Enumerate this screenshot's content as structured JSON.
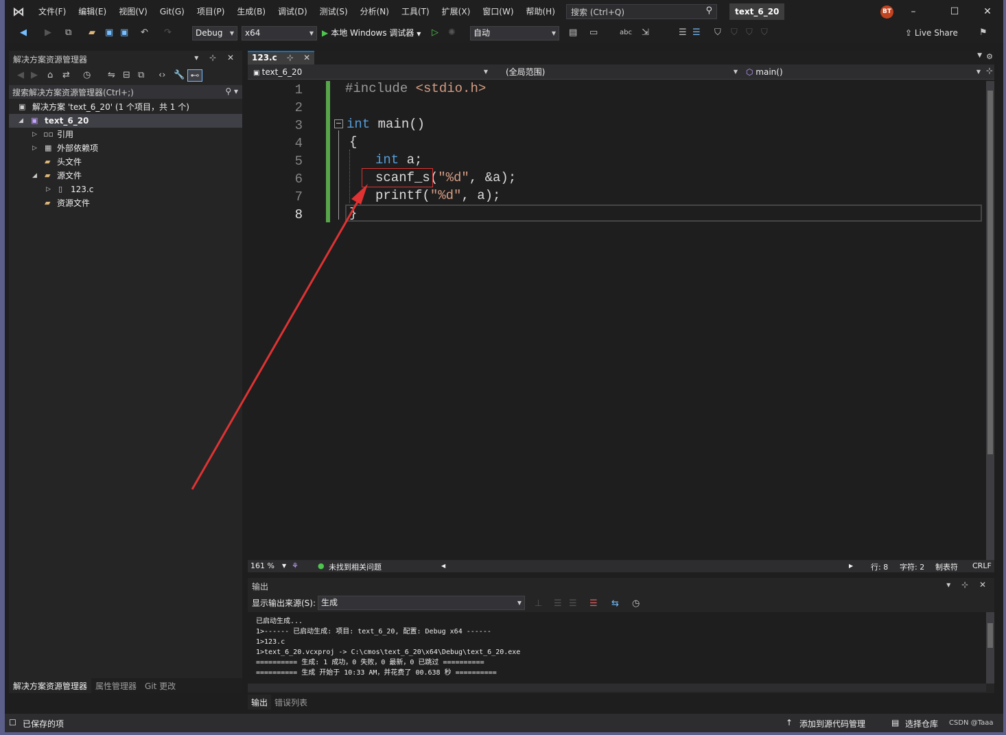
{
  "titlebar": {
    "menu": [
      "文件(F)",
      "编辑(E)",
      "视图(V)",
      "Git(G)",
      "项目(P)",
      "生成(B)",
      "调试(D)",
      "测试(S)",
      "分析(N)",
      "工具(T)",
      "扩展(X)",
      "窗口(W)",
      "帮助(H)"
    ],
    "search_placeholder": "搜索 (Ctrl+Q)",
    "solution_name": "text_6_20",
    "avatar_initials": "BT"
  },
  "toolbar": {
    "config": "Debug",
    "platform": "x64",
    "run_label": "本地 Windows 调试器",
    "auto_label": "自动",
    "live_share": "Live Share"
  },
  "solution_explorer": {
    "title": "解决方案资源管理器",
    "search_placeholder": "搜索解决方案资源管理器(Ctrl+;)",
    "tree": [
      {
        "label": "解决方案 'text_6_20' (1 个项目，共 1 个)"
      },
      {
        "label": "text_6_20"
      },
      {
        "label": "引用"
      },
      {
        "label": "外部依赖项"
      },
      {
        "label": "头文件"
      },
      {
        "label": "源文件"
      },
      {
        "label": "123.c"
      },
      {
        "label": "资源文件"
      }
    ],
    "bottom_tabs": [
      "解决方案资源管理器",
      "属性管理器",
      "Git 更改"
    ]
  },
  "editor": {
    "tab_name": "123.c",
    "nav_project": "text_6_20",
    "nav_scope": "(全局范围)",
    "nav_function": "main()",
    "line_numbers": [
      "1",
      "2",
      "3",
      "4",
      "5",
      "6",
      "7",
      "8"
    ],
    "zoom": "161 %",
    "issues": "未找到相关问题",
    "line_info": "行: 8",
    "char_info": "字符: 2",
    "tab_mode": "制表符",
    "eol": "CRLF"
  },
  "output": {
    "title": "输出",
    "source_label": "显示输出来源(S):",
    "source_value": "生成",
    "lines": [
      "已启动生成...",
      "1>------ 已启动生成: 项目: text_6_20, 配置: Debug x64 ------",
      "1>123.c",
      "1>text_6_20.vcxproj -> C:\\cmos\\text_6_20\\x64\\Debug\\text_6_20.exe",
      "========== 生成: 1 成功，0 失败，0 最新，0 已跳过 ==========",
      "========== 生成 开始于 10:33 AM，并花费了 00.638 秒 =========="
    ],
    "tabs": [
      "输出",
      "错误列表"
    ]
  },
  "statusbar": {
    "left": "已保存的项",
    "add_source": "添加到源代码管理",
    "select_repo": "选择仓库",
    "watermark": "CSDN @Taaa"
  }
}
